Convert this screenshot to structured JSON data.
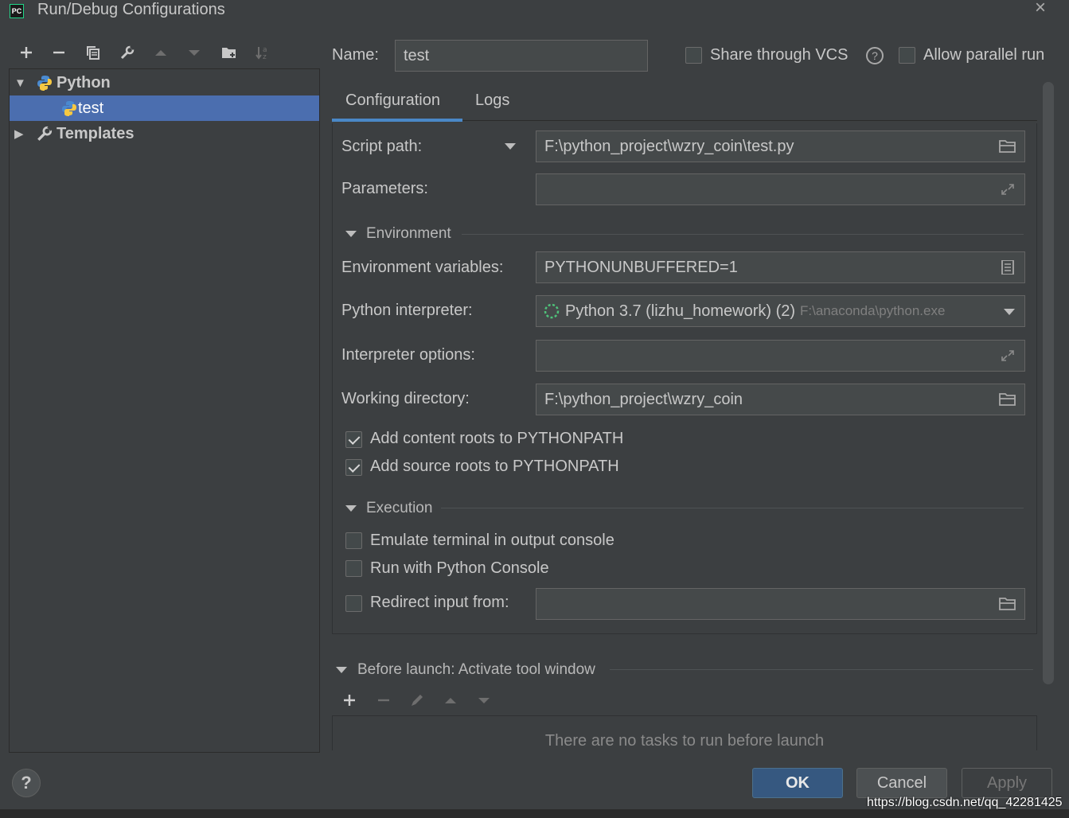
{
  "window": {
    "title": "Run/Debug Configurations",
    "app_icon_text": "PC"
  },
  "toolbar": {
    "icons": [
      "add-icon",
      "remove-icon",
      "copy-icon",
      "wrench-icon",
      "move-up-icon",
      "move-down-icon",
      "new-folder-icon",
      "sort-icon"
    ]
  },
  "tree": {
    "python_label": "Python",
    "test_label": "test",
    "templates_label": "Templates"
  },
  "header": {
    "name_label": "Name:",
    "name_value": "test",
    "share_vcs_label": "Share through VCS",
    "parallel_label": "Allow parallel run"
  },
  "tabs": [
    {
      "label": "Configuration"
    },
    {
      "label": "Logs"
    }
  ],
  "config": {
    "script_path_label": "Script path:",
    "script_path_value": "F:\\python_project\\wzry_coin\\test.py",
    "parameters_label": "Parameters:",
    "parameters_value": "",
    "environment_header": "Environment",
    "env_vars_label": "Environment variables:",
    "env_vars_value": "PYTHONUNBUFFERED=1",
    "interpreter_label": "Python interpreter:",
    "interpreter_value": "Python 3.7 (lizhu_homework) (2)",
    "interpreter_path": "F:\\anaconda\\python.exe",
    "interp_options_label": "Interpreter options:",
    "interp_options_value": "",
    "working_dir_label": "Working directory:",
    "working_dir_value": "F:\\python_project\\wzry_coin",
    "content_roots_label": "Add content roots to PYTHONPATH",
    "content_roots_checked": true,
    "source_roots_label": "Add source roots to PYTHONPATH",
    "source_roots_checked": true,
    "execution_header": "Execution",
    "emulate_terminal_label": "Emulate terminal in output console",
    "emulate_terminal_checked": false,
    "python_console_label": "Run with Python Console",
    "python_console_checked": false,
    "redirect_label": "Redirect input from:",
    "redirect_checked": false,
    "redirect_value": ""
  },
  "before_launch": {
    "header": "Before launch: Activate tool window",
    "empty_text": "There are no tasks to run before launch"
  },
  "buttons": {
    "ok": "OK",
    "cancel": "Cancel",
    "apply": "Apply",
    "help": "?"
  },
  "watermark": "https://blog.csdn.net/qq_42281425",
  "colors": {
    "background": "#3c3f41",
    "selection": "#4b6eaf",
    "tab_accent": "#4a88c7",
    "ok_button": "#365880",
    "spinner": "#4fc27a"
  }
}
